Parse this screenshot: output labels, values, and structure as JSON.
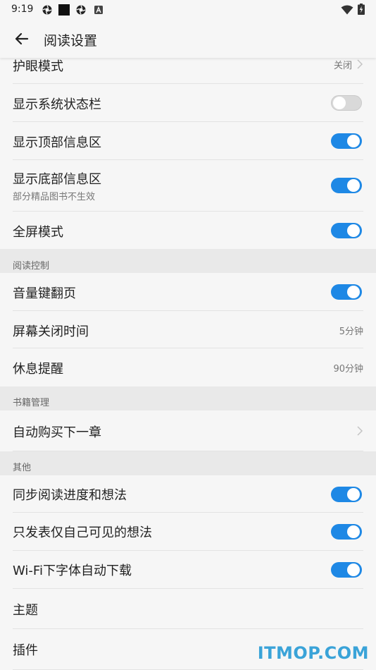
{
  "status_bar": {
    "time": "9:19",
    "icons": [
      "aperture-icon",
      "square-icon",
      "aperture-icon",
      "a-badge-icon",
      "wifi-icon",
      "battery-charging-icon"
    ]
  },
  "app_bar": {
    "title": "阅读设置",
    "back_icon": "arrow-left-icon"
  },
  "rows_top": {
    "eye_care": {
      "label": "护眼模式",
      "value": "关闭"
    },
    "show_status_bar": {
      "label": "显示系统状态栏",
      "on": false
    },
    "show_top_info": {
      "label": "显示顶部信息区",
      "on": true
    },
    "show_bottom_info": {
      "label": "显示底部信息区",
      "sub": "部分精品图书不生效",
      "on": true
    },
    "fullscreen": {
      "label": "全屏模式",
      "on": true
    }
  },
  "section_reading": {
    "title": "阅读控制",
    "volume_page": {
      "label": "音量键翻页",
      "on": true
    },
    "screen_off": {
      "label": "屏幕关闭时间",
      "value": "5分钟"
    },
    "rest_reminder": {
      "label": "休息提醒",
      "value": "90分钟"
    }
  },
  "section_books": {
    "title": "书籍管理",
    "auto_buy": {
      "label": "自动购买下一章"
    }
  },
  "section_other": {
    "title": "其他",
    "sync_progress": {
      "label": "同步阅读进度和想法",
      "on": true
    },
    "publish_private": {
      "label": "只发表仅自己可见的想法",
      "on": true
    },
    "wifi_font_download": {
      "label": "Wi-Fi下字体自动下载",
      "on": true
    },
    "theme": {
      "label": "主题"
    },
    "plugins": {
      "label": "插件"
    }
  },
  "watermark": "ITMOP.COM",
  "colors": {
    "accent": "#1e88e5",
    "background": "#f6f6f6",
    "section_bg": "#e9e9e9",
    "watermark": "#3aa3d8"
  }
}
